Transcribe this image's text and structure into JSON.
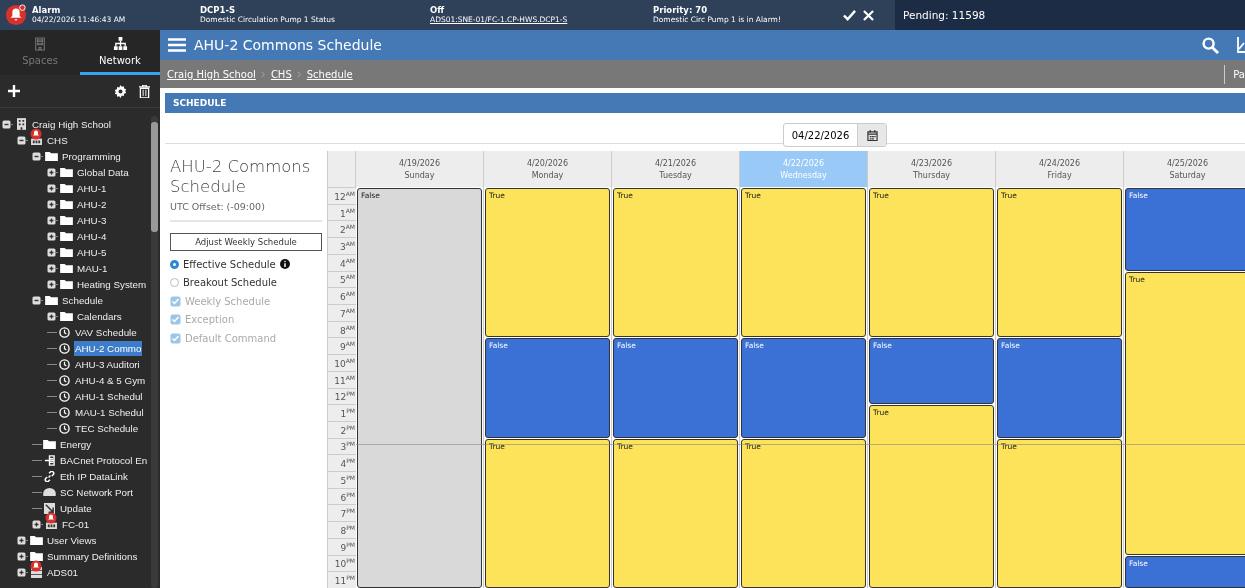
{
  "alarm_bar": {
    "title": "Alarm",
    "timestamp": "04/22/2026 11:46:43 AM",
    "point": "DCP1-S",
    "point_description": "Domestic Circulation Pump 1 Status",
    "value": "Off",
    "path": "ADS01:SNE-01/FC-1.CP-HWS.DCP1-S",
    "priority": "Priority: 70",
    "message": "Domestic Circ Pump 1 is in Alarm!",
    "pending": "Pending: 11598"
  },
  "sidebar": {
    "tabs": [
      {
        "label": "Spaces",
        "kind": "building",
        "selected": false
      },
      {
        "label": "Network",
        "kind": "network",
        "selected": true
      }
    ],
    "tree": [
      {
        "label": "Craig High School",
        "kind": "building",
        "expanded": true,
        "selected": false,
        "alarm": false,
        "children": [
          {
            "label": "CHS",
            "kind": "device",
            "expanded": true,
            "selected": false,
            "alarm": true,
            "children": [
              {
                "label": "Programming",
                "kind": "folder",
                "expanded": true,
                "selected": false,
                "alarm": false,
                "children": [
                  {
                    "label": "Global Data",
                    "kind": "folder",
                    "expanded": false,
                    "selected": false,
                    "alarm": false
                  },
                  {
                    "label": "AHU-1",
                    "kind": "folder",
                    "expanded": false,
                    "selected": false,
                    "alarm": false
                  },
                  {
                    "label": "AHU-2",
                    "kind": "folder",
                    "expanded": false,
                    "selected": false,
                    "alarm": false
                  },
                  {
                    "label": "AHU-3",
                    "kind": "folder",
                    "expanded": false,
                    "selected": false,
                    "alarm": false
                  },
                  {
                    "label": "AHU-4",
                    "kind": "folder",
                    "expanded": false,
                    "selected": false,
                    "alarm": false
                  },
                  {
                    "label": "AHU-5",
                    "kind": "folder",
                    "expanded": false,
                    "selected": false,
                    "alarm": false
                  },
                  {
                    "label": "MAU-1",
                    "kind": "folder",
                    "expanded": false,
                    "selected": false,
                    "alarm": false
                  },
                  {
                    "label": "Heating System",
                    "kind": "folder",
                    "expanded": false,
                    "selected": false,
                    "alarm": false
                  }
                ]
              },
              {
                "label": "Schedule",
                "kind": "folder",
                "expanded": true,
                "selected": false,
                "alarm": false,
                "children": [
                  {
                    "label": "Calendars",
                    "kind": "folder",
                    "expanded": false,
                    "selected": false,
                    "alarm": false
                  },
                  {
                    "label": "VAV Schedule",
                    "kind": "clock",
                    "selected": false,
                    "alarm": false
                  },
                  {
                    "label": "AHU-2 Commo",
                    "kind": "clock",
                    "selected": true,
                    "alarm": false
                  },
                  {
                    "label": "AHU-3 Auditori",
                    "kind": "clock",
                    "selected": false,
                    "alarm": false
                  },
                  {
                    "label": "AHU-4 & 5 Gym",
                    "kind": "clock",
                    "selected": false,
                    "alarm": false
                  },
                  {
                    "label": "AHU-1 Schedul",
                    "kind": "clock",
                    "selected": false,
                    "alarm": false
                  },
                  {
                    "label": "MAU-1 Schedul",
                    "kind": "clock",
                    "selected": false,
                    "alarm": false
                  },
                  {
                    "label": "TEC Schedule",
                    "kind": "clock",
                    "selected": false,
                    "alarm": false
                  }
                ]
              },
              {
                "label": "Energy",
                "kind": "folder",
                "selected": false,
                "alarm": false
              },
              {
                "label": "BACnet Protocol En",
                "kind": "bacnet",
                "selected": false,
                "alarm": false
              },
              {
                "label": "Eth IP DataLink",
                "kind": "link",
                "selected": false,
                "alarm": false
              },
              {
                "label": "SC Network Port",
                "kind": "port",
                "selected": false,
                "alarm": false
              },
              {
                "label": "Update",
                "kind": "update",
                "selected": false,
                "alarm": false
              },
              {
                "label": "FC-01",
                "kind": "device",
                "expanded": false,
                "selected": false,
                "alarm": true
              }
            ]
          },
          {
            "label": "User Views",
            "kind": "folder",
            "expanded": false,
            "selected": false,
            "alarm": false
          },
          {
            "label": "Summary Definitions",
            "kind": "folder",
            "expanded": false,
            "selected": false,
            "alarm": false
          },
          {
            "label": "ADS01",
            "kind": "database",
            "expanded": false,
            "selected": false,
            "alarm": true
          }
        ]
      }
    ]
  },
  "header": {
    "title": "AHU-2 Commons Schedule",
    "breadcrumb": [
      "Craig High School",
      "CHS",
      "Schedule"
    ],
    "right_text": "Pa"
  },
  "panel": {
    "title": "SCHEDULE",
    "date": "04/22/2026",
    "info": {
      "title": "AHU-2 Commons Schedule",
      "utc_offset": "UTC Offset: (-09:00)",
      "button": "Adjust Weekly Schedule",
      "views": [
        {
          "label": "Effective Schedule",
          "selected": true,
          "info": true
        },
        {
          "label": "Breakout Schedule",
          "selected": false,
          "info": false
        }
      ],
      "filters": [
        {
          "label": "Weekly Schedule",
          "checked": true,
          "disabled": true
        },
        {
          "label": "Exception",
          "checked": true,
          "disabled": true
        },
        {
          "label": "Default Command",
          "checked": true,
          "disabled": true
        }
      ]
    },
    "hours": [
      "12$^{AM}$",
      "1$^{AM}$",
      "2$^{AM}$",
      "3$^{AM}$",
      "4$^{AM}$",
      "5$^{AM}$",
      "6$^{AM}$",
      "7$^{AM}$",
      "8$^{AM}$",
      "9$^{AM}$",
      "10$^{AM}$",
      "11$^{AM}$",
      "12$^{PM}$",
      "1$^{PM}$",
      "2$^{PM}$",
      "3$^{PM}$",
      "4$^{PM}$",
      "5$^{PM}$",
      "6$^{PM}$",
      "7$^{PM}$",
      "8$^{PM}$",
      "9$^{PM}$",
      "10$^{PM}$",
      "11$^{PM}$"
    ],
    "days": [
      {
        "date": "4/19/2026",
        "day": "Sunday",
        "selected": false,
        "blocks": [
          {
            "value": "False",
            "color": "#d9d9d9"
          }
        ]
      },
      {
        "date": "4/20/2026",
        "day": "Monday",
        "selected": false,
        "blocks": [
          {
            "value": "True",
            "color": "#fde35a"
          },
          {
            "value": "False",
            "color": "#3b70d4"
          },
          {
            "value": "True",
            "color": "#fde35a"
          }
        ]
      },
      {
        "date": "4/21/2026",
        "day": "Tuesday",
        "selected": false,
        "blocks": [
          {
            "value": "True",
            "color": "#fde35a"
          },
          {
            "value": "False",
            "color": "#3b70d4"
          },
          {
            "value": "True",
            "color": "#fde35a"
          }
        ]
      },
      {
        "date": "4/22/2026",
        "day": "Wednesday",
        "selected": true,
        "blocks": [
          {
            "value": "True",
            "color": "#fde35a"
          },
          {
            "value": "False",
            "color": "#3b70d4"
          },
          {
            "value": "True",
            "color": "#fde35a"
          }
        ]
      },
      {
        "date": "4/23/2026",
        "day": "Thursday",
        "selected": false,
        "blocks": [
          {
            "value": "True",
            "color": "#fde35a"
          },
          {
            "value": "False",
            "color": "#3b70d4"
          },
          {
            "value": "True",
            "color": "#fde35a"
          }
        ]
      },
      {
        "date": "4/24/2026",
        "day": "Friday",
        "selected": false,
        "blocks": [
          {
            "value": "True",
            "color": "#fde35a"
          },
          {
            "value": "False",
            "color": "#3b70d4"
          },
          {
            "value": "True",
            "color": "#fde35a"
          }
        ]
      },
      {
        "date": "4/25/2026",
        "day": "Saturday",
        "selected": false,
        "blocks": [
          {
            "value": "False",
            "color": "#3b70d4"
          },
          {
            "value": "True",
            "color": "#fde35a"
          },
          {
            "value": "False",
            "color": "#3b70d4"
          }
        ]
      }
    ]
  }
}
